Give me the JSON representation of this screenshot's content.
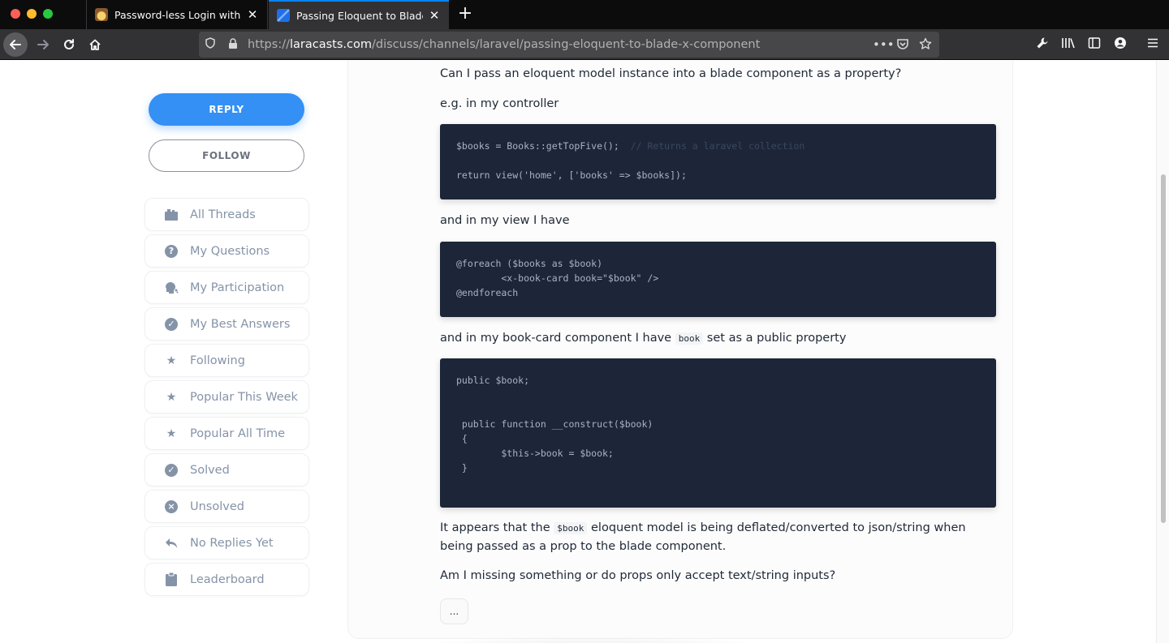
{
  "browser": {
    "tabs": [
      {
        "title": "Password-less Login with Magic",
        "close": "✕"
      },
      {
        "title": "Passing Eloquent to Blade x-com",
        "close": "✕"
      }
    ],
    "new_tab": "+",
    "url_scheme": "https://",
    "url_host": "laracasts.com",
    "url_path": "/discuss/channels/laravel/passing-eloquent-to-blade-x-component"
  },
  "sidebar": {
    "reply_label": "REPLY",
    "follow_label": "FOLLOW",
    "items": [
      {
        "label": "All Threads",
        "icon": "threads-icon"
      },
      {
        "label": "My Questions",
        "icon": "question-icon"
      },
      {
        "label": "My Participation",
        "icon": "participation-icon"
      },
      {
        "label": "My Best Answers",
        "icon": "check-circle-icon"
      },
      {
        "label": "Following",
        "icon": "star-icon"
      },
      {
        "label": "Popular This Week",
        "icon": "star-icon"
      },
      {
        "label": "Popular All Time",
        "icon": "star-icon"
      },
      {
        "label": "Solved",
        "icon": "check-circle-icon"
      },
      {
        "label": "Unsolved",
        "icon": "x-circle-icon"
      },
      {
        "label": "No Replies Yet",
        "icon": "reply-icon"
      },
      {
        "label": "Leaderboard",
        "icon": "clipboard-icon"
      }
    ]
  },
  "post": {
    "p1": "Can I pass an eloquent model instance into a blade component as a property?",
    "p2": "e.g. in my controller",
    "code1_line1": "$books = Books::getTopFive();",
    "code1_comment": "  // Returns a laravel collection",
    "code1_line2": "return view('home', ['books' => $books]);",
    "p3": "and in my view I have",
    "code2": "@foreach ($books as $book)\n        <x-book-card book=\"$book\" />\n@endforeach",
    "p4_before": "and in my book-card component I have ",
    "p4_code": "book",
    "p4_after": " set as a public property",
    "code3": "public $book;\n\n\n public function __construct($book)\n {\n        $this->book = $book;\n }",
    "p5_before": "It appears that the ",
    "p5_code": "$book",
    "p5_after": " eloquent model is being deflated/converted to json/string when being passed as a prop to the blade component.",
    "p6": "Am I missing something or do props only accept text/string inputs?",
    "more_label": "..."
  }
}
